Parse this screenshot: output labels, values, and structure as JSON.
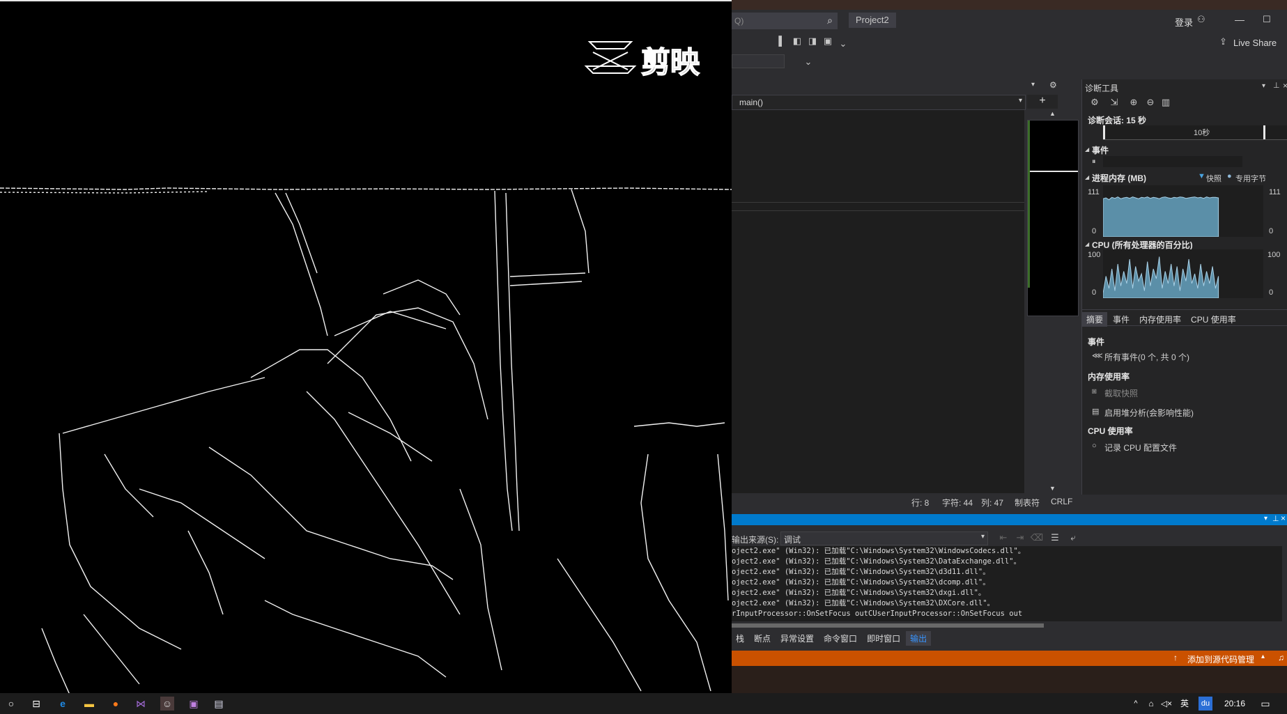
{
  "edge_window": {
    "logo_text": "剪映"
  },
  "vs": {
    "search_placeholder": "Q)",
    "project_name": "Project2",
    "login_label": "登录",
    "live_share_label": "Live Share",
    "function_dropdown": "main()",
    "status": {
      "line": "行: 8",
      "char": "字符: 44",
      "col": "列: 47",
      "tab": "制表符",
      "eol": "CRLF"
    },
    "diagnostics": {
      "title": "诊断工具",
      "session": "诊断会话: 15 秒",
      "timeline_tick": "10秒",
      "events_label": "事件",
      "memory_label": "进程内存 (MB)",
      "legend_snapshot": "快照",
      "legend_private": "专用字节",
      "memory_max": "111",
      "memory_min": "0",
      "memory_max_right": "111",
      "memory_min_right": "0",
      "cpu_label": "CPU (所有处理器的百分比)",
      "cpu_max": "100",
      "cpu_min": "0",
      "cpu_max_right": "100",
      "cpu_min_right": "0",
      "tabs": [
        "摘要",
        "事件",
        "内存使用率",
        "CPU 使用率"
      ],
      "summary": {
        "events_heading": "事件",
        "all_events": "所有事件(0 个, 共 0 个)",
        "memory_heading": "内存使用率",
        "take_snapshot": "截取快照",
        "heap_analysis": "启用堆分析(会影响性能)",
        "cpu_heading": "CPU 使用率",
        "record_cpu": "记录 CPU 配置文件"
      },
      "memory_series": [
        82,
        84,
        80,
        85,
        83,
        86,
        82,
        84,
        85,
        83,
        86,
        84,
        82,
        85,
        84,
        86,
        83,
        85,
        84,
        82,
        85,
        86,
        84,
        83,
        85,
        84,
        86,
        85,
        83,
        84,
        85,
        86,
        84,
        85,
        83,
        86,
        84,
        85,
        85,
        84
      ],
      "cpu_series": [
        10,
        45,
        20,
        60,
        15,
        70,
        25,
        55,
        30,
        80,
        20,
        65,
        35,
        50,
        15,
        75,
        25,
        60,
        40,
        85,
        20,
        55,
        30,
        70,
        25,
        65,
        15,
        60,
        35,
        80,
        30,
        50,
        20,
        70,
        25,
        55,
        30,
        65,
        20,
        45
      ]
    },
    "output": {
      "source_label": "输出来源(S):",
      "source_value": "调试",
      "lines": [
        "oject2.exe\" (Win32): 已加载\"C:\\Windows\\System32\\WindowsCodecs.dll\"。",
        "oject2.exe\" (Win32): 已加载\"C:\\Windows\\System32\\DataExchange.dll\"。",
        "oject2.exe\" (Win32): 已加载\"C:\\Windows\\System32\\d3d11.dll\"。",
        "oject2.exe\" (Win32): 已加载\"C:\\Windows\\System32\\dcomp.dll\"。",
        "oject2.exe\" (Win32): 已加载\"C:\\Windows\\System32\\dxgi.dll\"。",
        "oject2.exe\" (Win32): 已加载\"C:\\Windows\\System32\\DXCore.dll\"。",
        "rInputProcessor::OnSetFocus outCUserInputProcessor::OnSetFocus out"
      ],
      "bottom_tabs": [
        "栈",
        "断点",
        "异常设置",
        "命令窗口",
        "即时窗口",
        "输出"
      ]
    },
    "source_control": "添加到源代码管理"
  },
  "taskbar": {
    "tray_lang": "英",
    "tray_ime": "du",
    "clock": "20:16"
  },
  "colors": {
    "vs_blue": "#007acc",
    "vs_orange": "#ca5100",
    "chart_fill": "#5b8fa8"
  }
}
